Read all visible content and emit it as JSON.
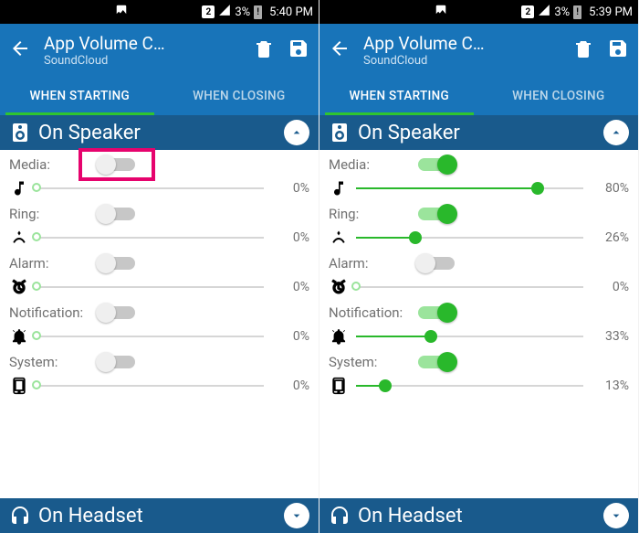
{
  "panes": [
    {
      "status": {
        "sim": "2",
        "battery_pct": "3%",
        "battery_warn": "!",
        "time": "5:40 PM"
      },
      "appbar": {
        "title": "App Volume C…",
        "subtitle": "SoundCloud"
      },
      "tabs": {
        "starting": "WHEN STARTING",
        "closing": "WHEN CLOSING",
        "active": "starting"
      },
      "section_speaker": {
        "title": "On Speaker",
        "expanded": true
      },
      "section_headset": {
        "title": "On Headset",
        "expanded": false
      },
      "rows": {
        "media": {
          "label": "Media:",
          "enabled": false,
          "pct": 0,
          "pct_label": "0%"
        },
        "ring": {
          "label": "Ring:",
          "enabled": false,
          "pct": 0,
          "pct_label": "0%"
        },
        "alarm": {
          "label": "Alarm:",
          "enabled": false,
          "pct": 0,
          "pct_label": "0%"
        },
        "notification": {
          "label": "Notification:",
          "enabled": false,
          "pct": 0,
          "pct_label": "0%"
        },
        "system": {
          "label": "System:",
          "enabled": false,
          "pct": 0,
          "pct_label": "0%"
        }
      },
      "highlight": {
        "row": "media",
        "target": "toggle"
      }
    },
    {
      "status": {
        "sim": "2",
        "battery_pct": "3%",
        "battery_warn": "!",
        "time": "5:39 PM"
      },
      "appbar": {
        "title": "App Volume C…",
        "subtitle": "SoundCloud"
      },
      "tabs": {
        "starting": "WHEN STARTING",
        "closing": "WHEN CLOSING",
        "active": "starting"
      },
      "section_speaker": {
        "title": "On Speaker",
        "expanded": true
      },
      "section_headset": {
        "title": "On Headset",
        "expanded": false
      },
      "rows": {
        "media": {
          "label": "Media:",
          "enabled": true,
          "pct": 80,
          "pct_label": "80%"
        },
        "ring": {
          "label": "Ring:",
          "enabled": true,
          "pct": 26,
          "pct_label": "26%"
        },
        "alarm": {
          "label": "Alarm:",
          "enabled": false,
          "pct": 0,
          "pct_label": "0%"
        },
        "notification": {
          "label": "Notification:",
          "enabled": true,
          "pct": 33,
          "pct_label": "33%"
        },
        "system": {
          "label": "System:",
          "enabled": true,
          "pct": 13,
          "pct_label": "13%"
        }
      }
    }
  ],
  "colors": {
    "accent": "#1874b9",
    "section": "#195a8c",
    "green": "#29b82b",
    "highlight": "#e6036d"
  }
}
